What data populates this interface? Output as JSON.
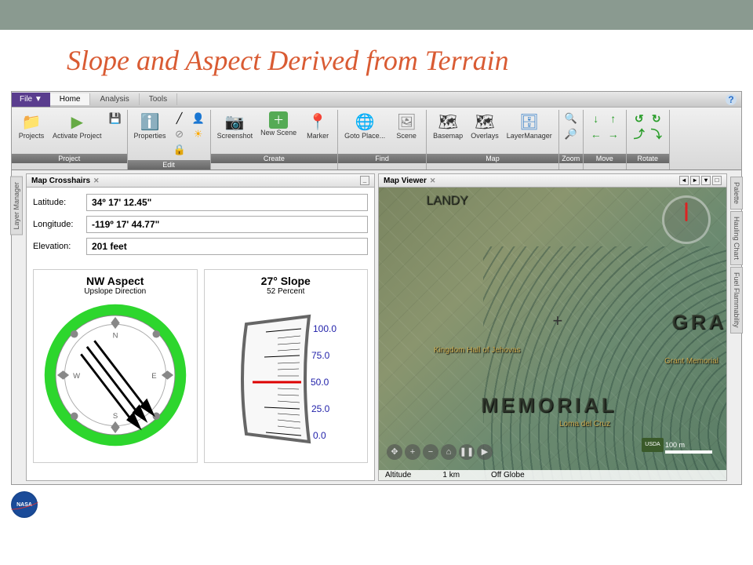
{
  "page_title": "Slope and Aspect Derived from Terrain",
  "menubar": {
    "file": "File ▼",
    "tabs": [
      "Home",
      "Analysis",
      "Tools"
    ]
  },
  "ribbon": {
    "groups": [
      {
        "label": "Project",
        "items": [
          "Projects",
          "Activate Project"
        ]
      },
      {
        "label": "Edit",
        "items": [
          "Properties"
        ]
      },
      {
        "label": "Create",
        "items": [
          "Screenshot",
          "New Scene",
          "Marker"
        ]
      },
      {
        "label": "Find",
        "items": [
          "Goto Place...",
          "Scene"
        ]
      },
      {
        "label": "Map",
        "items": [
          "Basemap",
          "Overlays",
          "LayerManager"
        ]
      },
      {
        "label": "Zoom"
      },
      {
        "label": "Move"
      },
      {
        "label": "Rotate"
      }
    ]
  },
  "left_panel": {
    "title": "Map Crosshairs",
    "side_tab": "Layer Manager",
    "latitude_label": "Latitude:",
    "latitude": "34º 17' 12.45\"",
    "longitude_label": "Longitude:",
    "longitude": "-119º 17' 44.77\"",
    "elevation_label": "Elevation:",
    "elevation": "201 feet",
    "aspect": {
      "title": "NW Aspect",
      "subtitle": "Upslope Direction",
      "n": "N",
      "s": "S",
      "e": "E",
      "w": "W"
    },
    "slope": {
      "title": "27° Slope",
      "subtitle": "52 Percent",
      "ticks": [
        "100.0",
        "75.0",
        "50.0",
        "25.0",
        "0.0"
      ]
    }
  },
  "right_panel": {
    "title": "Map Viewer",
    "side_tabs": [
      "Palette",
      "Hauling Chart",
      "Fuel Flammability"
    ],
    "labels": {
      "kingdom": "Kingdom Hall of Jehovas",
      "memorial": "MEMORIAL",
      "loma": "Loma del Cruz",
      "grant": "Grant Memorial",
      "gra": "GRA",
      "landy": "LANDY"
    },
    "status": {
      "altitude": "Altitude",
      "dist": "1 km",
      "globe": "Off Globe"
    },
    "scale": "100 m",
    "usda": "USDA"
  },
  "footer_logo": "NASA"
}
